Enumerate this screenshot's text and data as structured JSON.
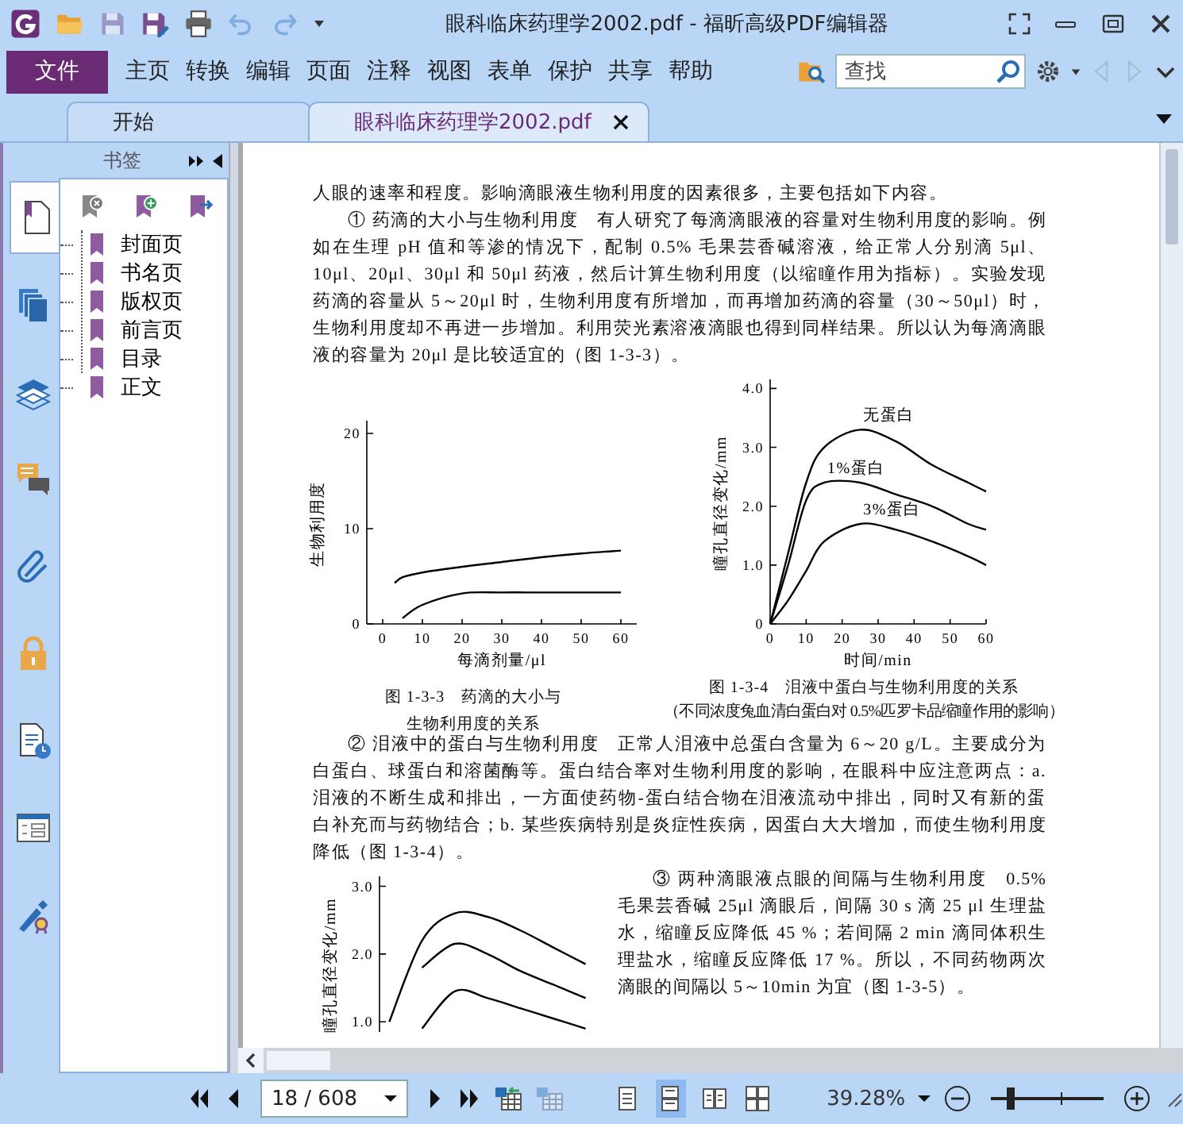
{
  "window": {
    "title": "眼科临床药理学2002.pdf - 福昕高级PDF编辑器"
  },
  "quick_toolbar": [
    {
      "kind": "open",
      "disabled": false
    },
    {
      "kind": "save",
      "disabled": true
    },
    {
      "kind": "save-as",
      "disabled": false
    },
    {
      "kind": "print",
      "disabled": false
    },
    {
      "kind": "undo",
      "disabled": true
    },
    {
      "kind": "redo",
      "disabled": true
    }
  ],
  "menu": {
    "file": "文件",
    "items": [
      "主页",
      "转换",
      "编辑",
      "页面",
      "注释",
      "视图",
      "表单",
      "保护",
      "共享",
      "帮助"
    ]
  },
  "search": {
    "placeholder": "查找"
  },
  "tabs": [
    {
      "label": "开始",
      "selected": false,
      "closable": false
    },
    {
      "label": "眼科临床药理学2002.pdf",
      "selected": true,
      "closable": true
    }
  ],
  "sidebar": {
    "tabs": [
      {
        "kind": "bookmarks",
        "selected": true
      },
      {
        "kind": "pages",
        "selected": false
      },
      {
        "kind": "layers",
        "selected": false
      },
      {
        "kind": "comments",
        "selected": false
      },
      {
        "kind": "attachments",
        "selected": false
      },
      {
        "kind": "security",
        "selected": false
      },
      {
        "kind": "accessibility",
        "selected": false
      },
      {
        "kind": "fields",
        "selected": false
      },
      {
        "kind": "signatures",
        "selected": false
      }
    ],
    "panel": {
      "title": "书签",
      "bookmarks": [
        {
          "label": "封面页"
        },
        {
          "label": "书名页"
        },
        {
          "label": "版权页"
        },
        {
          "label": "前言页"
        },
        {
          "label": "目录"
        },
        {
          "label": "正文"
        }
      ]
    }
  },
  "document": {
    "intro": "人眼的速率和程度。影响滴眼液生物利用度的因素很多，主要包括如下内容。",
    "section_1": "① 药滴的大小与生物利用度　有人研究了每滴滴眼液的容量对生物利用度的影响。例如在生理 pH 值和等渗的情况下，配制 0.5% 毛果芸香碱溶液，给正常人分别滴 5μl、10μl、20μl、30μl 和 50μl 药液，然后计算生物利用度（以缩瞳作用为指标）。实验发现药滴的容量从 5～20μl 时，生物利用度有所增加，而再增加药滴的容量（30～50μl）时，生物利用度却不再进一步增加。利用荧光素溶液滴眼也得到同样结果。所以认为每滴滴眼液的容量为 20μl 是比较适宜的（图 1-3-3）。",
    "figures": [
      {
        "caption": "图 1-3-3　药滴的大小与生物利用度的关系",
        "chart_data": {
          "type": "line",
          "xlabel": "每滴剂量/μl",
          "ylabel": "生物利用度",
          "x": [
            3,
            5,
            10,
            20,
            30,
            40,
            50,
            60
          ],
          "series": [
            {
              "color": "#000000",
              "values": [
                4.3,
                4.9,
                5.4,
                6.0,
                6.5,
                7.0,
                7.4,
                7.7
              ]
            },
            {
              "color": "#000000",
              "values": [
                null,
                0.6,
                2.0,
                3.2,
                3.3,
                3.3,
                3.3,
                3.3
              ]
            }
          ],
          "xlim": [
            -4,
            64
          ],
          "ylim": [
            0,
            21
          ],
          "xticks": [
            0,
            10,
            20,
            30,
            40,
            50,
            60
          ],
          "yticks": [
            0,
            10,
            20
          ]
        }
      },
      {
        "caption": "图 1-3-4　泪液中蛋白与生物利用度的关系",
        "note": "（不同浓度兔血清白蛋白对 0.5%匹罗卡品缩瞳作用的影响）",
        "chart_data": {
          "type": "line",
          "xlabel": "时间/min",
          "ylabel": "瞳孔直径变化/mm",
          "x": [
            0,
            5,
            10,
            15,
            25,
            35,
            45,
            55,
            60
          ],
          "series": [
            {
              "color": "#000000",
              "values": [
                0,
                1.2,
                2.4,
                3.0,
                3.3,
                3.1,
                2.7,
                2.4,
                2.25
              ]
            },
            {
              "color": "#000000",
              "values": [
                0,
                1.0,
                2.1,
                2.4,
                2.4,
                2.2,
                2.0,
                1.7,
                1.6
              ]
            },
            {
              "color": "#000000",
              "values": [
                0,
                0.4,
                0.9,
                1.4,
                1.7,
                1.6,
                1.4,
                1.15,
                1.0
              ]
            }
          ],
          "xlim": [
            0,
            60
          ],
          "ylim": [
            0,
            4.1
          ],
          "xticks": [
            0,
            10,
            20,
            30,
            40,
            50,
            60
          ],
          "yticks": [
            0,
            {
              "value": 1,
              "label": "1.0"
            },
            {
              "value": 2,
              "label": "2.0"
            },
            {
              "value": 3,
              "label": "3.0"
            },
            {
              "value": 4,
              "label": "4.0"
            }
          ],
          "annotations": [
            "无蛋白",
            "1%蛋白",
            "3%蛋白"
          ]
        }
      }
    ],
    "section_2": "② 泪液中的蛋白与生物利用度　正常人泪液中总蛋白含量为 6～20 g/L。主要成分为白蛋白、球蛋白和溶菌酶等。蛋白结合率对生物利用度的影响，在眼科中应注意两点：a. 泪液的不断生成和排出，一方面使药物-蛋白结合物在泪液流动中排出，同时又有新的蛋白补充而与药物结合；b. 某些疾病特别是炎症性疾病，因蛋白大大增加，而使生物利用度降低（图 1-3-4）。",
    "figure_3": {
      "chart_data": {
        "type": "line",
        "ylabel": "瞳孔直径变化/mm",
        "ylim": [
          0.85,
          3.1
        ],
        "yticks": [
          {
            "value": 1,
            "label": "1.0"
          },
          {
            "value": 2,
            "label": "2.0"
          },
          {
            "value": 3,
            "label": "3.0"
          }
        ],
        "series": [
          {
            "color": "#000000",
            "values": [
              1.0,
              2.2,
              2.6,
              2.55,
              2.35,
              2.1,
              1.85
            ]
          },
          {
            "color": "#000000",
            "values": [
              null,
              1.8,
              2.15,
              2.0,
              1.75,
              1.55,
              1.35
            ]
          },
          {
            "color": "#000000",
            "values": [
              null,
              0.9,
              1.45,
              1.35,
              1.2,
              1.05,
              0.9
            ]
          }
        ]
      }
    },
    "section_3": "③ 两种滴眼液点眼的间隔与生物利用度　0.5% 毛果芸香碱 25μl 滴眼后，间隔 30 s 滴 25 μl 生理盐水，缩瞳反应降低 45 %；若间隔 2 min 滴同体积生理盐水，缩瞳反应降低 17 %。所以，不同药物两次滴眼的间隔以 5～10min 为宜（图 1-3-5）。"
  },
  "status_bar": {
    "page": "18 / 608",
    "view_modes": [
      {
        "kind": "single",
        "selected": false
      },
      {
        "kind": "continuous",
        "selected": true
      },
      {
        "kind": "facing",
        "selected": false
      },
      {
        "kind": "continuous-facing",
        "selected": false
      }
    ],
    "zoom": {
      "value": "39.28%",
      "level": 0.17
    }
  }
}
